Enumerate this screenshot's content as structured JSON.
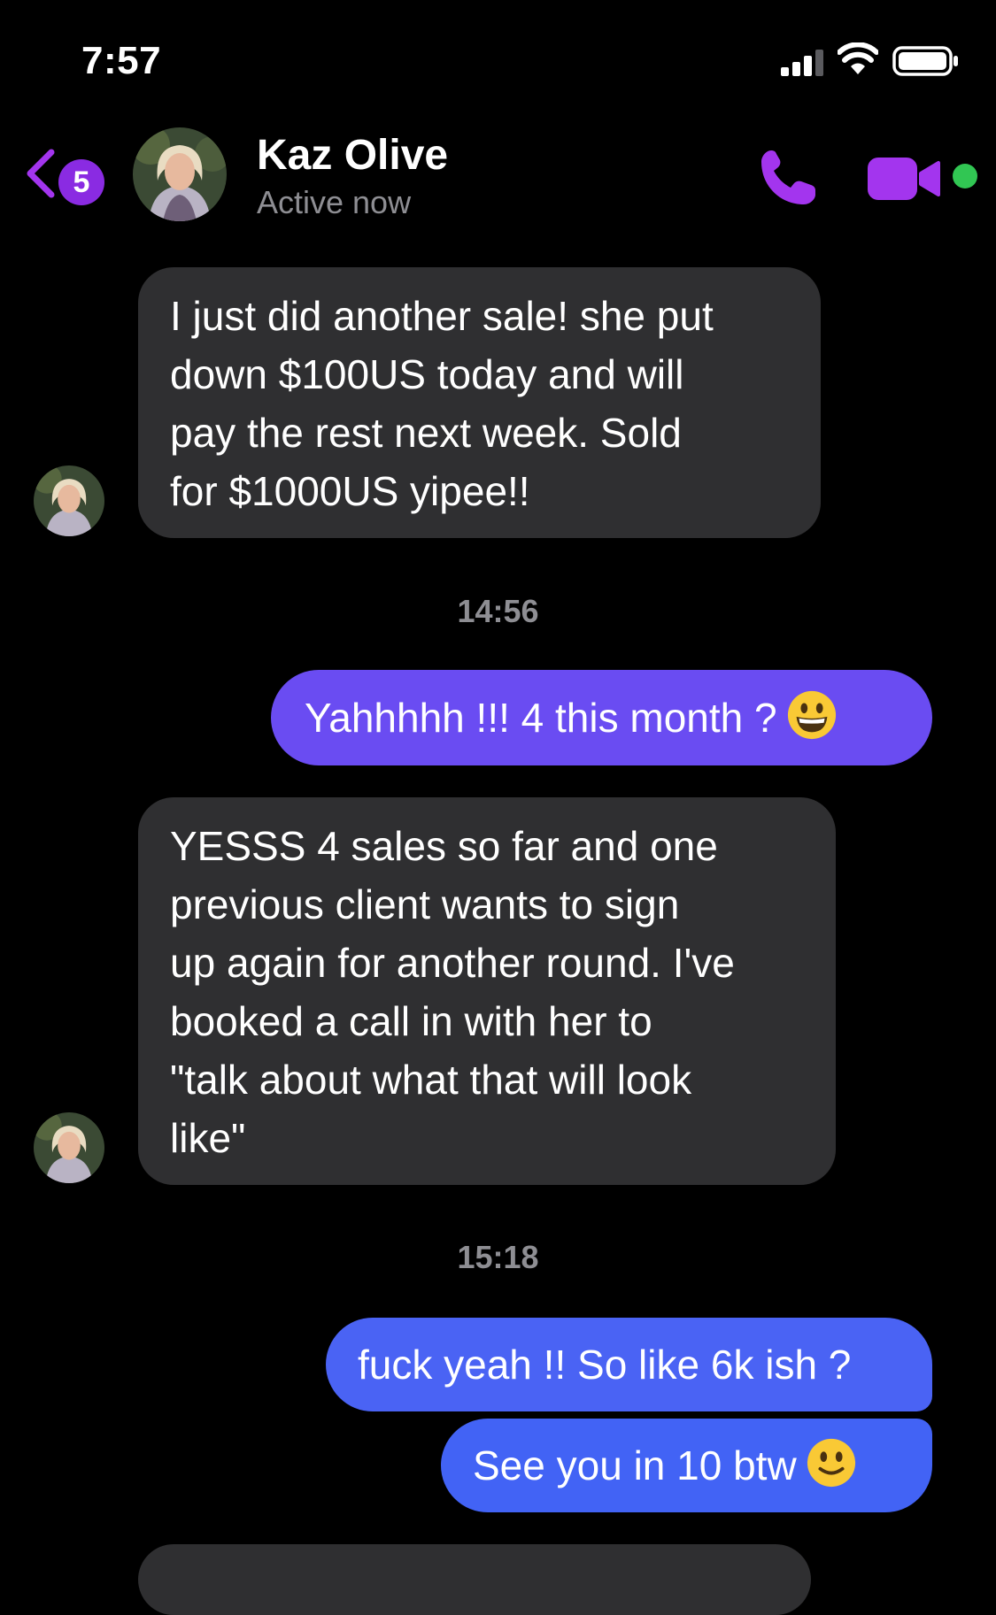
{
  "status_bar": {
    "time": "7:57",
    "icons": [
      "cellular-signal-icon",
      "wifi-icon",
      "battery-icon"
    ]
  },
  "header": {
    "back_badge": "5",
    "contact_name": "Kaz Olive",
    "contact_status": "Active now",
    "icons": [
      "back-chevron-icon",
      "phone-icon",
      "video-camera-icon",
      "online-dot"
    ]
  },
  "messages": [
    {
      "direction": "incoming",
      "text": "I just did another sale! she put\ndown $100US today and will\npay the rest next week. Sold\nfor $1000US yipee!!"
    },
    {
      "type": "timestamp",
      "text": "14:56"
    },
    {
      "direction": "outgoing",
      "text": "Yahhhhh !!! 4 this month ?",
      "emoji": "grinning-face-emoji"
    },
    {
      "direction": "incoming",
      "text": "YESSS 4 sales so far and one\nprevious client wants to sign\nup again for another round. I've\nbooked a call in with her to\n\"talk about what that will look\nlike\""
    },
    {
      "type": "timestamp",
      "text": "15:18"
    },
    {
      "direction": "outgoing",
      "text": "fuck yeah !! So like 6k ish ?"
    },
    {
      "direction": "outgoing",
      "text": "See you in 10 btw",
      "emoji": "slightly-smiling-face-emoji"
    }
  ],
  "colors": {
    "background": "#000000",
    "incoming_bubble": "#2f2f31",
    "outgoing_purple": "#6a4cf2",
    "outgoing_blue": "#4a63f4",
    "accent": "#a335ee",
    "online": "#31c653",
    "secondary_text": "#8e8e93"
  }
}
